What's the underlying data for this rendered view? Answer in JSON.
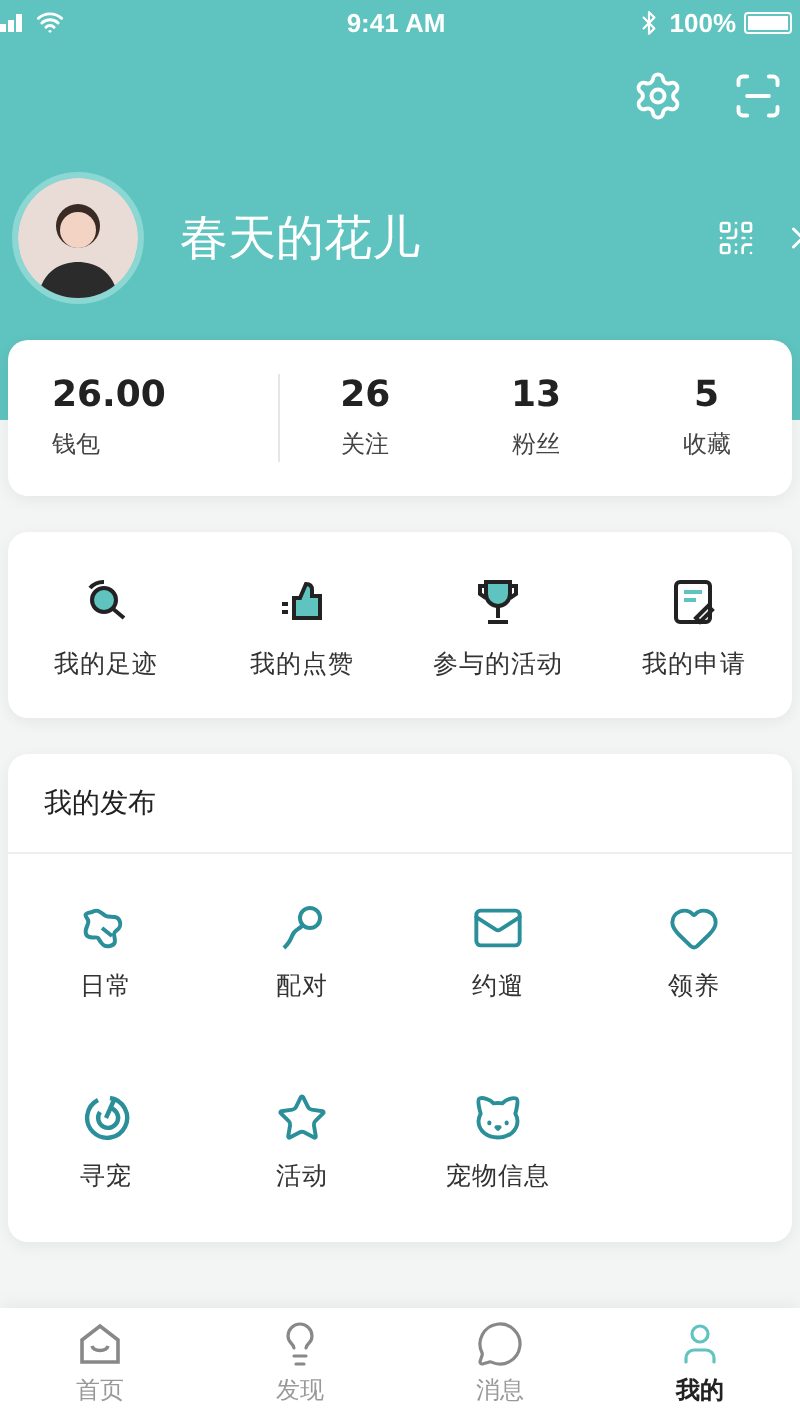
{
  "status_bar": {
    "time": "9:41 AM",
    "battery": "100%"
  },
  "profile": {
    "name": "春天的花儿"
  },
  "stats": [
    {
      "value": "26.00",
      "label": "钱包"
    },
    {
      "value": "26",
      "label": "关注"
    },
    {
      "value": "13",
      "label": "粉丝"
    },
    {
      "value": "5",
      "label": "收藏"
    }
  ],
  "shortcuts": [
    {
      "label": "我的足迹"
    },
    {
      "label": "我的点赞"
    },
    {
      "label": "参与的活动"
    },
    {
      "label": "我的申请"
    }
  ],
  "posts": {
    "title": "我的发布",
    "items": [
      {
        "label": "日常"
      },
      {
        "label": "配对"
      },
      {
        "label": "约遛"
      },
      {
        "label": "领养"
      },
      {
        "label": "寻宠"
      },
      {
        "label": "活动"
      },
      {
        "label": "宠物信息"
      }
    ]
  },
  "tab_bar": [
    {
      "label": "首页",
      "selected": false
    },
    {
      "label": "发现",
      "selected": false
    },
    {
      "label": "消息",
      "selected": false
    },
    {
      "label": "我的",
      "selected": true
    }
  ]
}
